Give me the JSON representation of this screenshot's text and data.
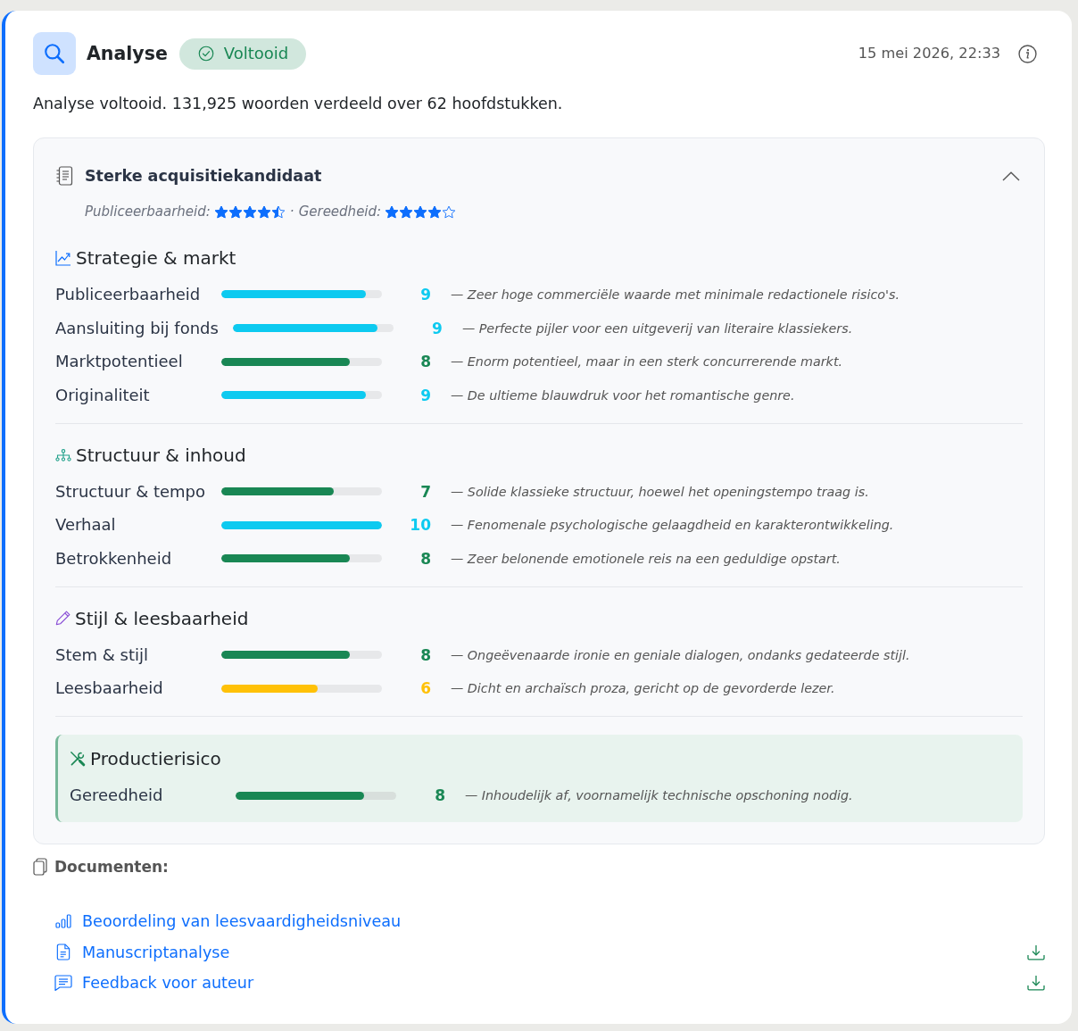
{
  "header": {
    "title": "Analyse",
    "status": {
      "label": "Voltooid",
      "kind": "done"
    },
    "timestamp": "15 mei 2026, 22:33"
  },
  "summary": "Analyse voltooid. 131,925 woorden verdeeld over 62 hoofdstukken.",
  "panel": {
    "title": "Sterke acquisitiekandidaat",
    "expanded": true,
    "ratings": [
      {
        "label": "Publiceerbaarheid:",
        "stars": 4.5
      },
      {
        "label": "Gereedheid:",
        "stars": 4
      }
    ],
    "separator": "·",
    "sections": [
      {
        "title": "Strategie & markt",
        "kind": "group",
        "rows": [
          {
            "label": "Publiceerbaarheid",
            "level": 0.9,
            "score": "9",
            "comment": "— Zeer hoge commerciële waarde met minimale redactionele risico's."
          },
          {
            "label": "Aansluiting bij fonds",
            "level": 0.9,
            "score": "9",
            "comment": "— Perfecte pijler voor een uitgeverij van literaire klassiekers."
          },
          {
            "label": "Marktpotentieel",
            "level": 0.8,
            "score": "8",
            "comment": "— Enorm potentieel, maar in een sterk concurrerende markt."
          },
          {
            "label": "Originaliteit",
            "level": 0.9,
            "score": "9",
            "comment": "— De ultieme blauwdruk voor het romantische genre."
          }
        ]
      },
      {
        "title": "Structuur & inhoud",
        "kind": "group",
        "rows": [
          {
            "label": "Structuur & tempo",
            "level": 0.7,
            "score": "7",
            "comment": "— Solide klassieke structuur, hoewel het openingstempo traag is."
          },
          {
            "label": "Verhaal",
            "level": 1,
            "score": "10",
            "comment": "— Fenomenale psychologische gelaagdheid en karakterontwikkeling."
          },
          {
            "label": "Betrokkenheid",
            "level": 0.8,
            "score": "8",
            "comment": "— Zeer belonende emotionele reis na een geduldige opstart."
          }
        ]
      },
      {
        "title": "Stijl & leesbaarheid",
        "kind": "group",
        "rows": [
          {
            "label": "Stem & stijl",
            "level": 0.8,
            "score": "8",
            "comment": "— Ongeëvenaarde ironie en geniale dialogen, ondanks gedateerde stijl."
          },
          {
            "label": "Leesbaarheid",
            "level": 0.6,
            "score": "6",
            "comment": "— Dicht en archaïsch proza, gericht op de gevorderde lezer."
          }
        ]
      },
      {
        "title": "Productierisico",
        "kind": "callout",
        "rows": [
          {
            "label": "Gereedheid",
            "level": 0.8,
            "score": "8",
            "comment": "— Inhoudelijk af, voornamelijk technische opschoning nodig."
          }
        ]
      }
    ]
  },
  "documents": {
    "title": "Documenten:",
    "items": [
      {
        "label": "Beoordeling van leesvaardigheidsniveau",
        "downloadable": false
      },
      {
        "label": "Manuscriptanalyse",
        "downloadable": true
      },
      {
        "label": "Feedback voor auteur",
        "downloadable": true
      }
    ]
  }
}
